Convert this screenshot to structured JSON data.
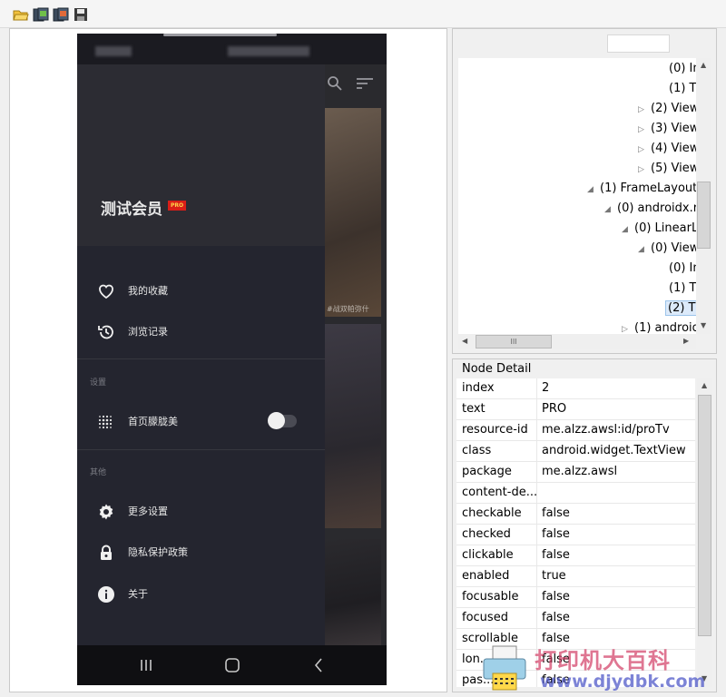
{
  "toolbar": {
    "buttons": [
      {
        "name": "open-icon"
      },
      {
        "name": "screenshot-icon"
      },
      {
        "name": "screenshot-alt-icon"
      },
      {
        "name": "save-icon"
      }
    ]
  },
  "phone": {
    "drawer": {
      "title": "测试会员",
      "badge": "PRO",
      "items": [
        {
          "label": "我的收藏",
          "icon": "heart-icon"
        },
        {
          "label": "浏览记录",
          "icon": "history-icon"
        }
      ],
      "section_settings": "设置",
      "setting_item": {
        "label": "首页朦胧美",
        "icon": "dots-grid-icon",
        "toggle_on": false
      },
      "section_other": "其他",
      "other_items": [
        {
          "label": "更多设置",
          "icon": "gear-icon"
        },
        {
          "label": "隐私保护政策",
          "icon": "lock-icon"
        },
        {
          "label": "关于",
          "icon": "info-icon"
        }
      ]
    },
    "bg_overlay_text": "#战双帕弥什"
  },
  "tree": {
    "rows": [
      {
        "label": "(0) In",
        "expandable": false
      },
      {
        "label": "(1) T",
        "expandable": false
      },
      {
        "label": "(2) View",
        "expandable": true,
        "state": "collapsed"
      },
      {
        "label": "(3) View",
        "expandable": true,
        "state": "collapsed"
      },
      {
        "label": "(4) View",
        "expandable": true,
        "state": "collapsed"
      },
      {
        "label": "(5) View",
        "expandable": true,
        "state": "collapsed"
      },
      {
        "label": "(1) FrameLayout",
        "expandable": true,
        "state": "expanded"
      },
      {
        "label": "(0) androidx.re",
        "expandable": true,
        "state": "expanded"
      },
      {
        "label": "(0) LinearLa",
        "expandable": true,
        "state": "expanded"
      },
      {
        "label": "(0) View",
        "expandable": true,
        "state": "expanded"
      },
      {
        "label": "(0) In",
        "expandable": false
      },
      {
        "label": "(1) T",
        "expandable": false
      },
      {
        "label": "(2) T",
        "expandable": false,
        "selected": true
      },
      {
        "label": "(1) android",
        "expandable": true,
        "state": "collapsed"
      }
    ]
  },
  "detail": {
    "title": "Node Detail",
    "rows": [
      {
        "key": "index",
        "value": "2"
      },
      {
        "key": "text",
        "value": "PRO"
      },
      {
        "key": "resource-id",
        "value": "me.alzz.awsl:id/proTv"
      },
      {
        "key": "class",
        "value": "android.widget.TextView"
      },
      {
        "key": "package",
        "value": "me.alzz.awsl"
      },
      {
        "key": "content-de...",
        "value": ""
      },
      {
        "key": "checkable",
        "value": "false"
      },
      {
        "key": "checked",
        "value": "false"
      },
      {
        "key": "clickable",
        "value": "false"
      },
      {
        "key": "enabled",
        "value": "true"
      },
      {
        "key": "focusable",
        "value": "false"
      },
      {
        "key": "focused",
        "value": "false"
      },
      {
        "key": "scrollable",
        "value": "false"
      },
      {
        "key": "lon...",
        "value": "false"
      },
      {
        "key": "pas...",
        "value": "false"
      }
    ]
  },
  "watermark": {
    "title": "打印机大百科",
    "url": "www.djydbk.com"
  }
}
